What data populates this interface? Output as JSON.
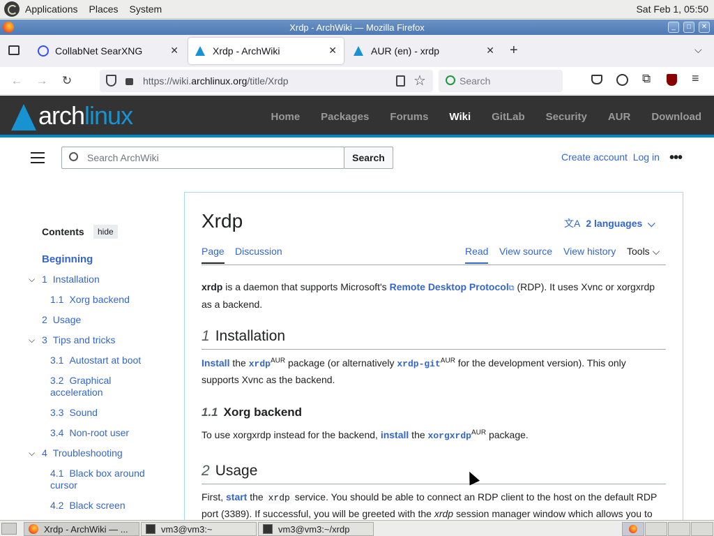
{
  "top_panel": {
    "menus": [
      "Applications",
      "Places",
      "System"
    ],
    "clock": "Sat Feb  1, 05:50"
  },
  "window": {
    "title": "Xrdp - ArchWiki — Mozilla Firefox"
  },
  "tabs": [
    {
      "label": "CollabNet SearXNG",
      "active": false
    },
    {
      "label": "Xrdp - ArchWiki",
      "active": true
    },
    {
      "label": "AUR (en) - xrdp",
      "active": false
    }
  ],
  "navbar": {
    "url_prefix": "https://wiki.",
    "url_domain": "archlinux.org",
    "url_path": "/title/Xrdp",
    "search_placeholder": "Search"
  },
  "arch": {
    "logo_a": "arch",
    "logo_b": "linux",
    "nav": [
      "Home",
      "Packages",
      "Forums",
      "Wiki",
      "GitLab",
      "Security",
      "AUR",
      "Download"
    ],
    "current": "Wiki"
  },
  "wiki_header": {
    "search_placeholder": "Search ArchWiki",
    "search_button": "Search",
    "create_account": "Create account",
    "login": "Log in"
  },
  "toc": {
    "title": "Contents",
    "hide": "hide",
    "items": [
      {
        "num": "",
        "label": "Beginning"
      },
      {
        "num": "1",
        "label": "Installation"
      },
      {
        "num": "1.1",
        "label": "Xorg backend"
      },
      {
        "num": "2",
        "label": "Usage"
      },
      {
        "num": "3",
        "label": "Tips and tricks"
      },
      {
        "num": "3.1",
        "label": "Autostart at boot"
      },
      {
        "num": "3.2",
        "label": "Graphical acceleration"
      },
      {
        "num": "3.3",
        "label": "Sound"
      },
      {
        "num": "3.4",
        "label": "Non-root user"
      },
      {
        "num": "4",
        "label": "Troubleshooting"
      },
      {
        "num": "4.1",
        "label": "Black box around cursor"
      },
      {
        "num": "4.2",
        "label": "Black screen"
      }
    ]
  },
  "page": {
    "title": "Xrdp",
    "languages": "2 languages",
    "tabs": [
      "Page",
      "Discussion"
    ],
    "actions": [
      "Read",
      "View source",
      "View history",
      "Tools"
    ],
    "intro_b": "xrdp",
    "intro_1": " is a daemon that supports Microsoft's ",
    "intro_link": "Remote Desktop Protocol",
    "intro_2": " (RDP). It uses Xvnc or xorgxrdp as a backend.",
    "s1_num": "1",
    "s1": "Installation",
    "inst_link": "Install",
    "inst_1": " the ",
    "inst_pkg": "xrdp",
    "aur": "AUR",
    "inst_2": " package (or alternatively ",
    "inst_pkg2": "xrdp-git",
    "inst_3": " for the development version). This only supports Xvnc as the backend.",
    "s11_num": "1.1",
    "s11": "Xorg backend",
    "xorg_1": "To use xorgxrdp instead for the backend, ",
    "xorg_link": "install",
    "xorg_2": " the ",
    "xorg_pkg": "xorgxrdp",
    "xorg_3": " package.",
    "s2_num": "2",
    "s2": "Usage",
    "use_1": "First, ",
    "use_link": "start",
    "use_2": " the ",
    "use_code": "xrdp",
    "use_3": " service. You should be able to connect an RDP client to the host on the default RDP port (3389). If successful, you will be greeted with the ",
    "use_em": "xrdp",
    "use_4": " session manager window which allows you to"
  },
  "taskbar": {
    "tasks": [
      "Xrdp - ArchWiki — ...",
      "vm3@vm3:~",
      "vm3@vm3:~/xrdp"
    ]
  }
}
